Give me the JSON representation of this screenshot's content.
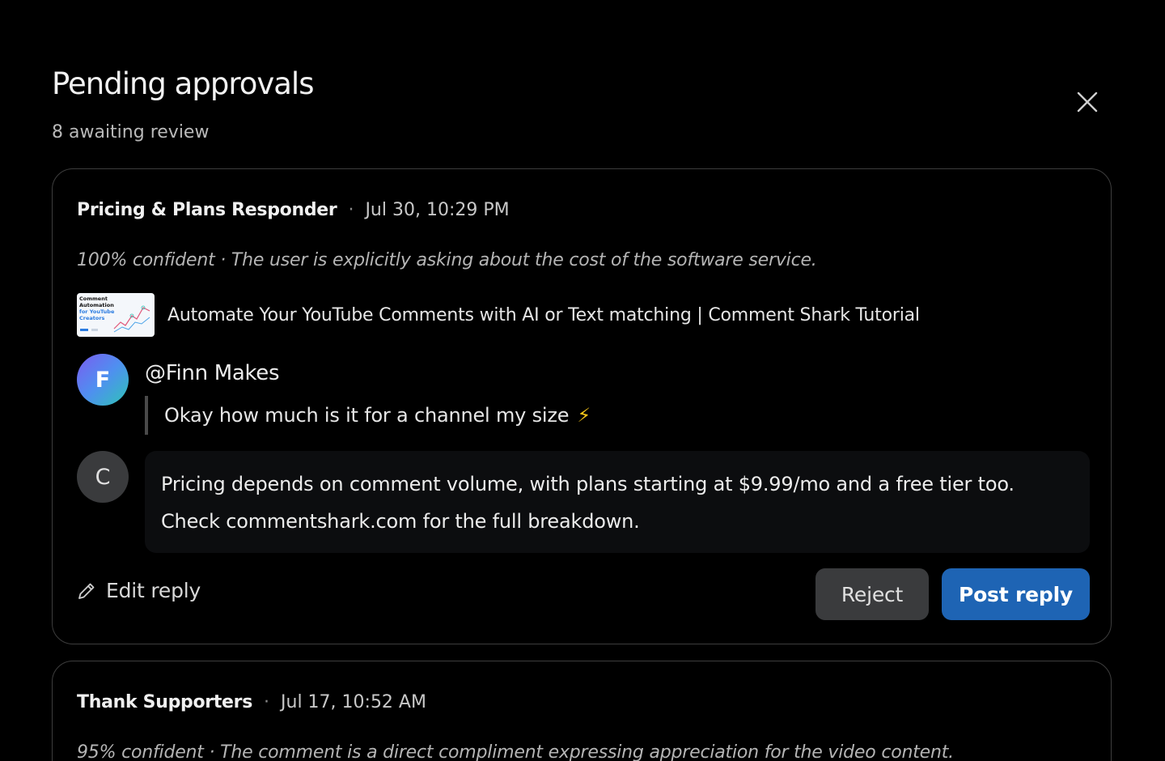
{
  "header": {
    "title": "Pending approvals",
    "subtitle": "8 awaiting review"
  },
  "icons": {
    "close": "close-icon",
    "edit": "pencil-icon",
    "bolt": "lightning-icon"
  },
  "colors": {
    "background": "#000000",
    "accent": "#1e64b4",
    "reject": "#3a3b3d",
    "bolt": "#f5c518"
  },
  "cards": [
    {
      "responder": "Pricing & Plans Responder",
      "separator": "·",
      "timestamp": "Jul 30, 10:29 PM",
      "confidence": "100% confident · The user is explicitly asking about the cost of the software service.",
      "video": {
        "thumbnail_text_line1": "Comment",
        "thumbnail_text_line2": "Automation",
        "thumbnail_text_line3": "for YouTube",
        "thumbnail_text_line4": "Creators",
        "title": "Automate Your YouTube Comments with AI or Text matching | Comment Shark Tutorial"
      },
      "comment": {
        "avatar_letter": "F",
        "author": "@Finn Makes",
        "text": "Okay how much is it for a channel my size",
        "emoji": "⚡"
      },
      "reply": {
        "avatar_letter": "C",
        "text_line1": "Pricing depends on comment volume, with plans starting at $9.99/mo and a free tier too.",
        "text_line2": "Check commentshark.com for the full breakdown."
      },
      "actions": {
        "edit_label": "Edit reply",
        "reject_label": "Reject",
        "post_label": "Post reply"
      }
    },
    {
      "responder": "Thank Supporters",
      "separator": "·",
      "timestamp": "Jul 17, 10:52 AM",
      "confidence": "95% confident · The comment is a direct compliment expressing appreciation for the video content."
    }
  ]
}
